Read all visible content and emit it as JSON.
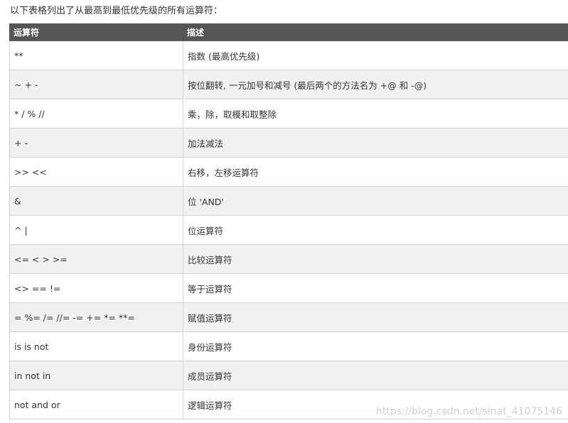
{
  "intro_text": "以下表格列出了从最高到最低优先级的所有运算符：",
  "table": {
    "headers": [
      "运算符",
      "描述"
    ],
    "rows": [
      {
        "op": "**",
        "desc": "指数 (最高优先级)"
      },
      {
        "op": "~ + -",
        "desc": "按位翻转, 一元加号和减号 (最后两个的方法名为 +@ 和 -@)"
      },
      {
        "op": "* / % //",
        "desc": "乘，除，取模和取整除"
      },
      {
        "op": "+ -",
        "desc": "加法减法"
      },
      {
        "op": ">> <<",
        "desc": "右移，左移运算符"
      },
      {
        "op": "&",
        "desc": "位 'AND'"
      },
      {
        "op": "^ |",
        "desc": "位运算符"
      },
      {
        "op": "<= < > >=",
        "desc": "比较运算符"
      },
      {
        "op": "<> == !=",
        "desc": "等于运算符"
      },
      {
        "op": "= %= /= //= -= += *= **=",
        "desc": "赋值运算符"
      },
      {
        "op": "is is not",
        "desc": "身份运算符"
      },
      {
        "op": "in not in",
        "desc": "成员运算符"
      },
      {
        "op": "not and or",
        "desc": "逻辑运算符"
      }
    ]
  },
  "watermark": "https://blog.csdn.net/sinat_41075146",
  "colors": {
    "header_bg": "#555555",
    "header_text": "#ffffff",
    "row_alt_bg": "#f1f1f1",
    "border": "#d4d4d4",
    "text": "#333333"
  }
}
